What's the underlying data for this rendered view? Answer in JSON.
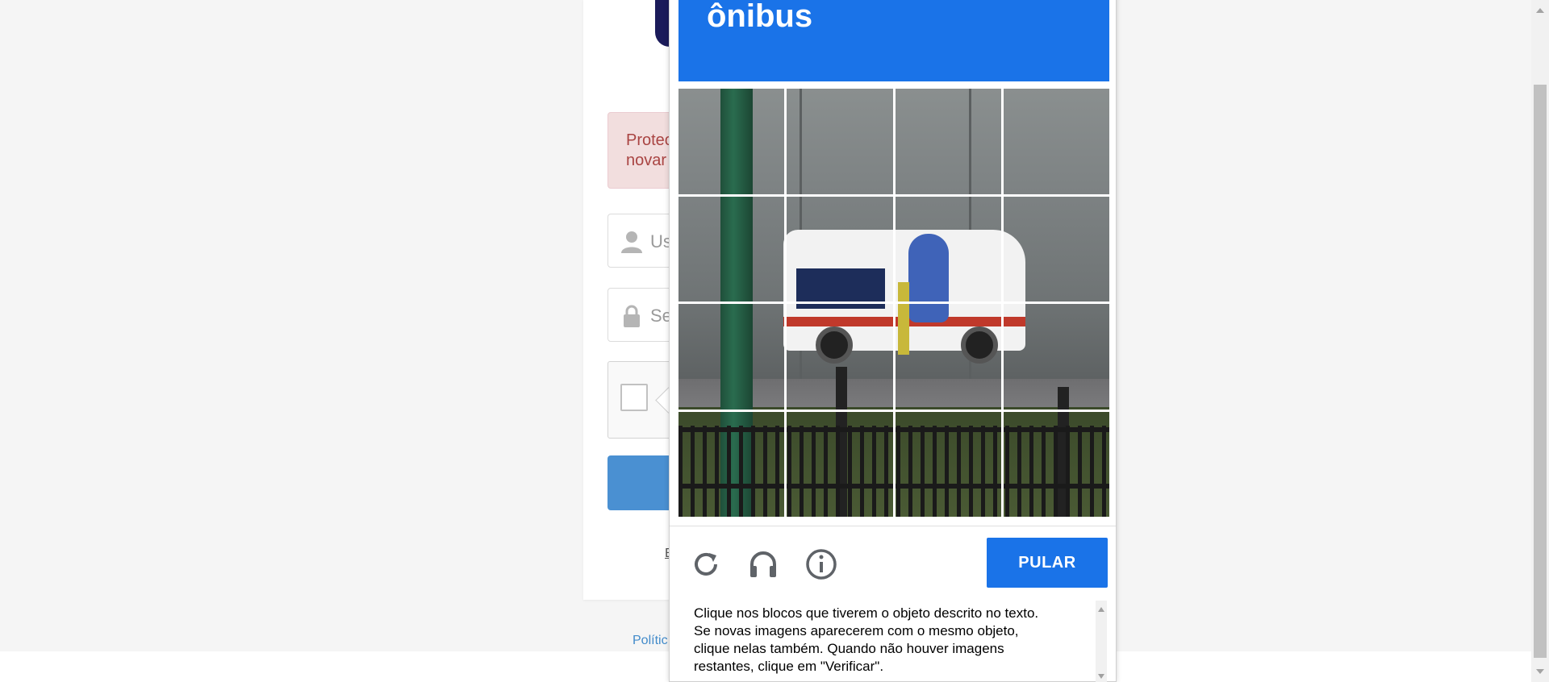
{
  "login": {
    "alert_text": "Protec\nnovar",
    "username_placeholder": "Us",
    "password_placeholder": "Se",
    "footer_link": "E",
    "policy_link": "Polític"
  },
  "captcha": {
    "target_word": "ônibus",
    "skip_label": "PULAR",
    "instructions": "Clique nos blocos que tiverem o objeto descrito no texto.\nSe novas imagens aparecerem com o mesmo objeto,\nclique nelas também. Quando não houver imagens\nrestantes, clique em \"Verificar\".",
    "tile_count": 16,
    "icons": [
      "reload-icon",
      "audio-icon",
      "info-icon"
    ]
  },
  "colors": {
    "captcha_blue": "#1a73e8",
    "login_button_blue": "#4a90d2",
    "alert_bg": "#f2dede",
    "alert_text": "#a94442"
  }
}
